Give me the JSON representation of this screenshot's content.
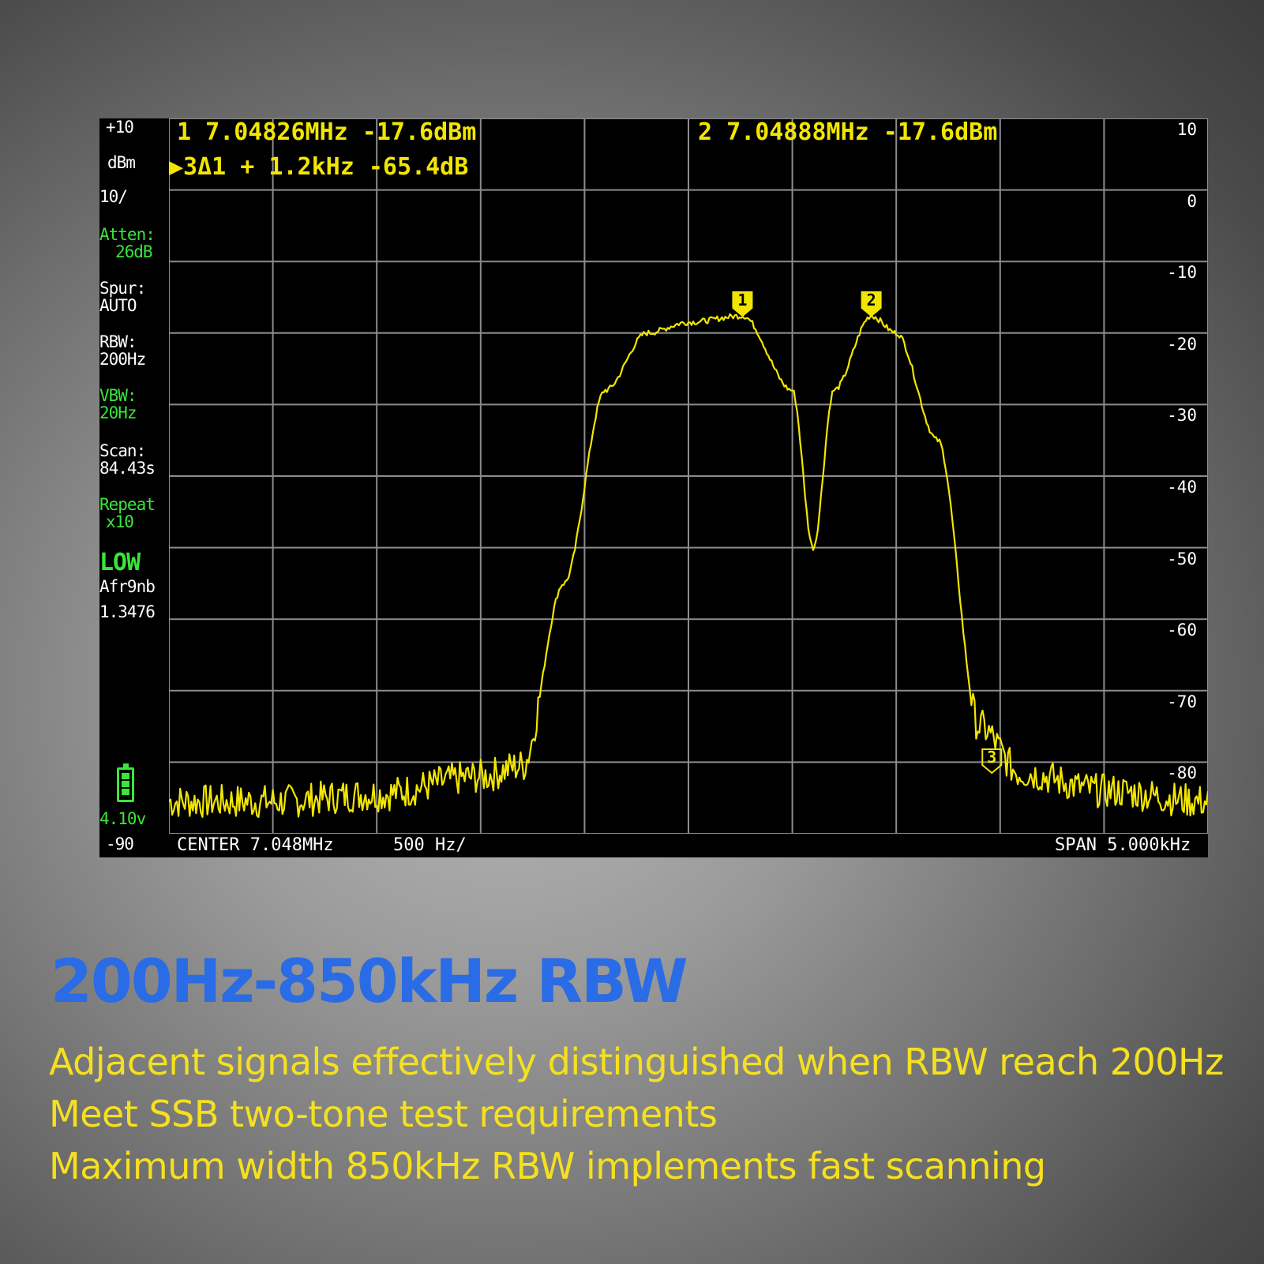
{
  "screen": {
    "ref_top": "+10",
    "unit": "dBm",
    "scale": "10/",
    "atten_label": "Atten:",
    "atten_value": "26dB",
    "spur_label": "Spur:",
    "spur_value": "AUTO",
    "rbw_label": "RBW:",
    "rbw_value": "200Hz",
    "vbw_label": "VBW:",
    "vbw_value": "20Hz",
    "scan_label": "Scan:",
    "scan_value": "84.43s",
    "repeat_label": "Repeat",
    "repeat_value": "x10",
    "mode": "LOW",
    "afrgnb": "Afr9nb",
    "afrgnb_value": "1.3476",
    "battery_voltage": "4.10v",
    "ref_bottom": "-90",
    "marker1_readout": "1  7.04826MHz -17.6dBm",
    "marker2_readout": "2  7.04888MHz -17.6dBm",
    "delta_readout": "▶3Δ1 +    1.2kHz -65.4dB",
    "center": "CENTER 7.048MHz",
    "per_div": "500 Hz/",
    "span": "SPAN 5.000kHz",
    "y_ticks": [
      "10",
      "0",
      "-10",
      "-20",
      "-30",
      "-40",
      "-50",
      "-60",
      "-70",
      "-80"
    ],
    "markers": [
      "1",
      "2",
      "3"
    ],
    "trace_color": "#f2e600",
    "grid_color": "#8c8c8c"
  },
  "chart_data": {
    "type": "line",
    "x": [
      7.0455,
      7.046,
      7.0465,
      7.047,
      7.0472,
      7.0474,
      7.0476,
      7.0478,
      7.048,
      7.04826,
      7.0485,
      7.0486,
      7.0487,
      7.04888,
      7.049,
      7.0492,
      7.0494,
      7.0496,
      7.05,
      7.0505
    ],
    "values": [
      -85.5,
      -85.5,
      -84.5,
      -82,
      -80.5,
      -55,
      -28,
      -20,
      -18.5,
      -17.6,
      -28,
      -50,
      -28,
      -17.6,
      -20,
      -35,
      -75,
      -81.5,
      -84,
      -85.5
    ],
    "xlabel": "",
    "ylabel": "",
    "xlim": [
      7.0455,
      7.0505
    ],
    "ylim": [
      -90,
      10
    ],
    "grid": true,
    "series": [
      {
        "values": [
          -85.5,
          -85.5,
          -84.5,
          -82,
          -80.5,
          -55,
          -28,
          -20,
          -18.5,
          -17.6,
          -28,
          -50,
          -28,
          -17.6,
          -20,
          -35,
          -75,
          -81.5,
          -84,
          -85.5
        ]
      }
    ]
  },
  "headline": "200Hz-850kHz RBW",
  "features": [
    "Adjacent signals effectively distinguished when RBW reach 200Hz",
    "Meet SSB two-tone test requirements",
    "Maximum width  850kHz      RBW implements fast scanning"
  ]
}
